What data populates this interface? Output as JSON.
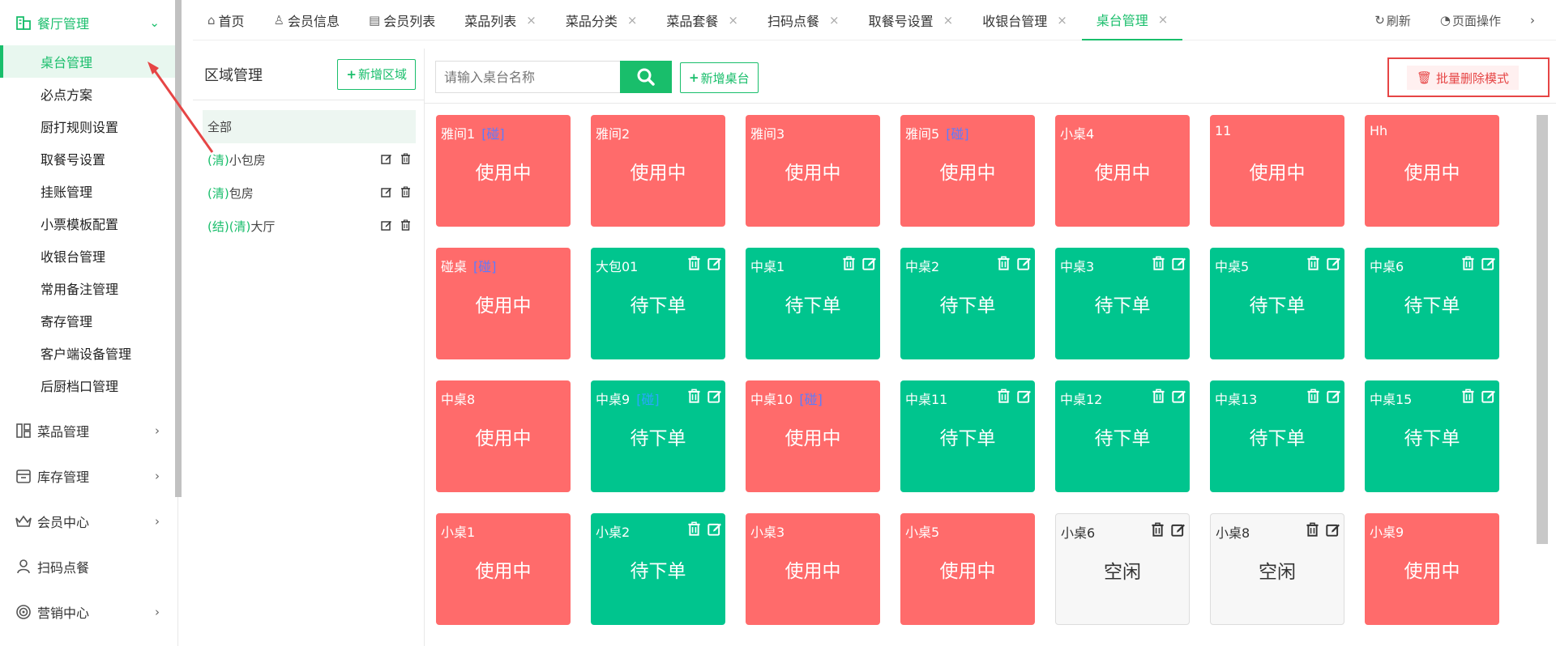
{
  "sidebar": {
    "main_group": "餐厅管理",
    "items": [
      "桌台管理",
      "必点方案",
      "厨打规则设置",
      "取餐号设置",
      "挂账管理",
      "小票模板配置",
      "收银台管理",
      "常用备注管理",
      "寄存管理",
      "客户端设备管理",
      "后厨档口管理"
    ],
    "groups": [
      "菜品管理",
      "库存管理",
      "会员中心",
      "扫码点餐",
      "营销中心"
    ]
  },
  "tabs": [
    {
      "label": "首页",
      "icon": "home-icon",
      "closable": false
    },
    {
      "label": "会员信息",
      "icon": "user-icon",
      "closable": false
    },
    {
      "label": "会员列表",
      "icon": "list-icon",
      "closable": false
    },
    {
      "label": "菜品列表",
      "closable": true
    },
    {
      "label": "菜品分类",
      "closable": true
    },
    {
      "label": "菜品套餐",
      "closable": true
    },
    {
      "label": "扫码点餐",
      "closable": true
    },
    {
      "label": "取餐号设置",
      "closable": true
    },
    {
      "label": "收银台管理",
      "closable": true
    },
    {
      "label": "桌台管理",
      "closable": true,
      "active": true
    }
  ],
  "top_right": {
    "refresh": "刷新",
    "page_ops": "页面操作"
  },
  "region": {
    "title": "区域管理",
    "add_label": "新增区域",
    "all_label": "全部",
    "items": [
      {
        "prefix": "(清)",
        "name": "小包房"
      },
      {
        "prefix": "(清)",
        "name": "包房"
      },
      {
        "prefix": "(结)(清)",
        "name": "大厅"
      }
    ]
  },
  "toolbar": {
    "search_placeholder": "请输入桌台名称",
    "add_table_label": "新增桌台",
    "batch_delete_label": "批量删除模式"
  },
  "status_colors": {
    "使用中": "#ff6b6b",
    "待下单": "#00c58e",
    "空闲": "#f7f7f7"
  },
  "tables": [
    {
      "name": "雅间1",
      "tag": "[碰]",
      "status": "使用中",
      "ops": false
    },
    {
      "name": "雅间2",
      "tag": "",
      "status": "使用中",
      "ops": false
    },
    {
      "name": "雅间3",
      "tag": "",
      "status": "使用中",
      "ops": false
    },
    {
      "name": "雅间5",
      "tag": "[碰]",
      "status": "使用中",
      "ops": false
    },
    {
      "name": "小桌4",
      "tag": "",
      "status": "使用中",
      "ops": false
    },
    {
      "name": "11",
      "tag": "",
      "status": "使用中",
      "ops": false
    },
    {
      "name": "Hh",
      "tag": "",
      "status": "使用中",
      "ops": false
    },
    {
      "name": "碰桌",
      "tag": "[碰]",
      "status": "使用中",
      "ops": false
    },
    {
      "name": "大包01",
      "tag": "",
      "status": "待下单",
      "ops": true
    },
    {
      "name": "中桌1",
      "tag": "",
      "status": "待下单",
      "ops": true
    },
    {
      "name": "中桌2",
      "tag": "",
      "status": "待下单",
      "ops": true
    },
    {
      "name": "中桌3",
      "tag": "",
      "status": "待下单",
      "ops": true
    },
    {
      "name": "中桌5",
      "tag": "",
      "status": "待下单",
      "ops": true
    },
    {
      "name": "中桌6",
      "tag": "",
      "status": "待下单",
      "ops": true
    },
    {
      "name": "中桌8",
      "tag": "",
      "status": "使用中",
      "ops": false
    },
    {
      "name": "中桌9",
      "tag": "[碰]",
      "status": "待下单",
      "ops": true
    },
    {
      "name": "中桌10",
      "tag": "[碰]",
      "status": "使用中",
      "ops": false
    },
    {
      "name": "中桌11",
      "tag": "",
      "status": "待下单",
      "ops": true
    },
    {
      "name": "中桌12",
      "tag": "",
      "status": "待下单",
      "ops": true
    },
    {
      "name": "中桌13",
      "tag": "",
      "status": "待下单",
      "ops": true
    },
    {
      "name": "中桌15",
      "tag": "",
      "status": "待下单",
      "ops": true
    },
    {
      "name": "小桌1",
      "tag": "",
      "status": "使用中",
      "ops": false
    },
    {
      "name": "小桌2",
      "tag": "",
      "status": "待下单",
      "ops": true
    },
    {
      "name": "小桌3",
      "tag": "",
      "status": "使用中",
      "ops": false
    },
    {
      "name": "小桌5",
      "tag": "",
      "status": "使用中",
      "ops": false
    },
    {
      "name": "小桌6",
      "tag": "",
      "status": "空闲",
      "ops": true
    },
    {
      "name": "小桌8",
      "tag": "",
      "status": "空闲",
      "ops": true
    },
    {
      "name": "小桌9",
      "tag": "",
      "status": "使用中",
      "ops": false
    }
  ]
}
